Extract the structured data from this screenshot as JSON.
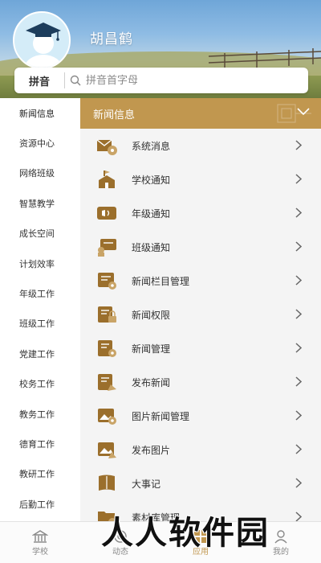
{
  "header": {
    "user_name": "胡昌鹤"
  },
  "search": {
    "mode_label": "拼音",
    "placeholder": "拼音首字母"
  },
  "sidebar": {
    "items": [
      {
        "label": "新闻信息"
      },
      {
        "label": "资源中心"
      },
      {
        "label": "网络班级"
      },
      {
        "label": "智慧教学"
      },
      {
        "label": "成长空间"
      },
      {
        "label": "计划效率"
      },
      {
        "label": "年级工作"
      },
      {
        "label": "班级工作"
      },
      {
        "label": "党建工作"
      },
      {
        "label": "校务工作"
      },
      {
        "label": "教务工作"
      },
      {
        "label": "德育工作"
      },
      {
        "label": "教研工作"
      },
      {
        "label": "后勤工作"
      }
    ]
  },
  "section": {
    "title": "新闻信息",
    "items": [
      {
        "label": "系统消息",
        "icon": "system-message-icon"
      },
      {
        "label": "学校通知",
        "icon": "school-notice-icon"
      },
      {
        "label": "年级通知",
        "icon": "grade-notice-icon"
      },
      {
        "label": "班级通知",
        "icon": "class-notice-icon"
      },
      {
        "label": "新闻栏目管理",
        "icon": "news-column-icon"
      },
      {
        "label": "新闻权限",
        "icon": "news-permission-icon"
      },
      {
        "label": "新闻管理",
        "icon": "news-manage-icon"
      },
      {
        "label": "发布新闻",
        "icon": "publish-news-icon"
      },
      {
        "label": "图片新闻管理",
        "icon": "photo-news-icon"
      },
      {
        "label": "发布图片",
        "icon": "publish-photo-icon"
      },
      {
        "label": "大事记",
        "icon": "chronicle-icon"
      },
      {
        "label": "素材库管理",
        "icon": "material-library-icon"
      }
    ]
  },
  "tabbar": {
    "tabs": [
      {
        "label": "学校",
        "icon": "school-building-icon"
      },
      {
        "label": "动态",
        "icon": "dynamics-icon"
      },
      {
        "label": "应用",
        "icon": "apps-icon"
      },
      {
        "label": "我的",
        "icon": "profile-icon"
      }
    ]
  },
  "watermark": "人人软件园",
  "colors": {
    "accent": "#c1974f",
    "icon_brown": "#9b6f2c",
    "text": "#333333"
  }
}
